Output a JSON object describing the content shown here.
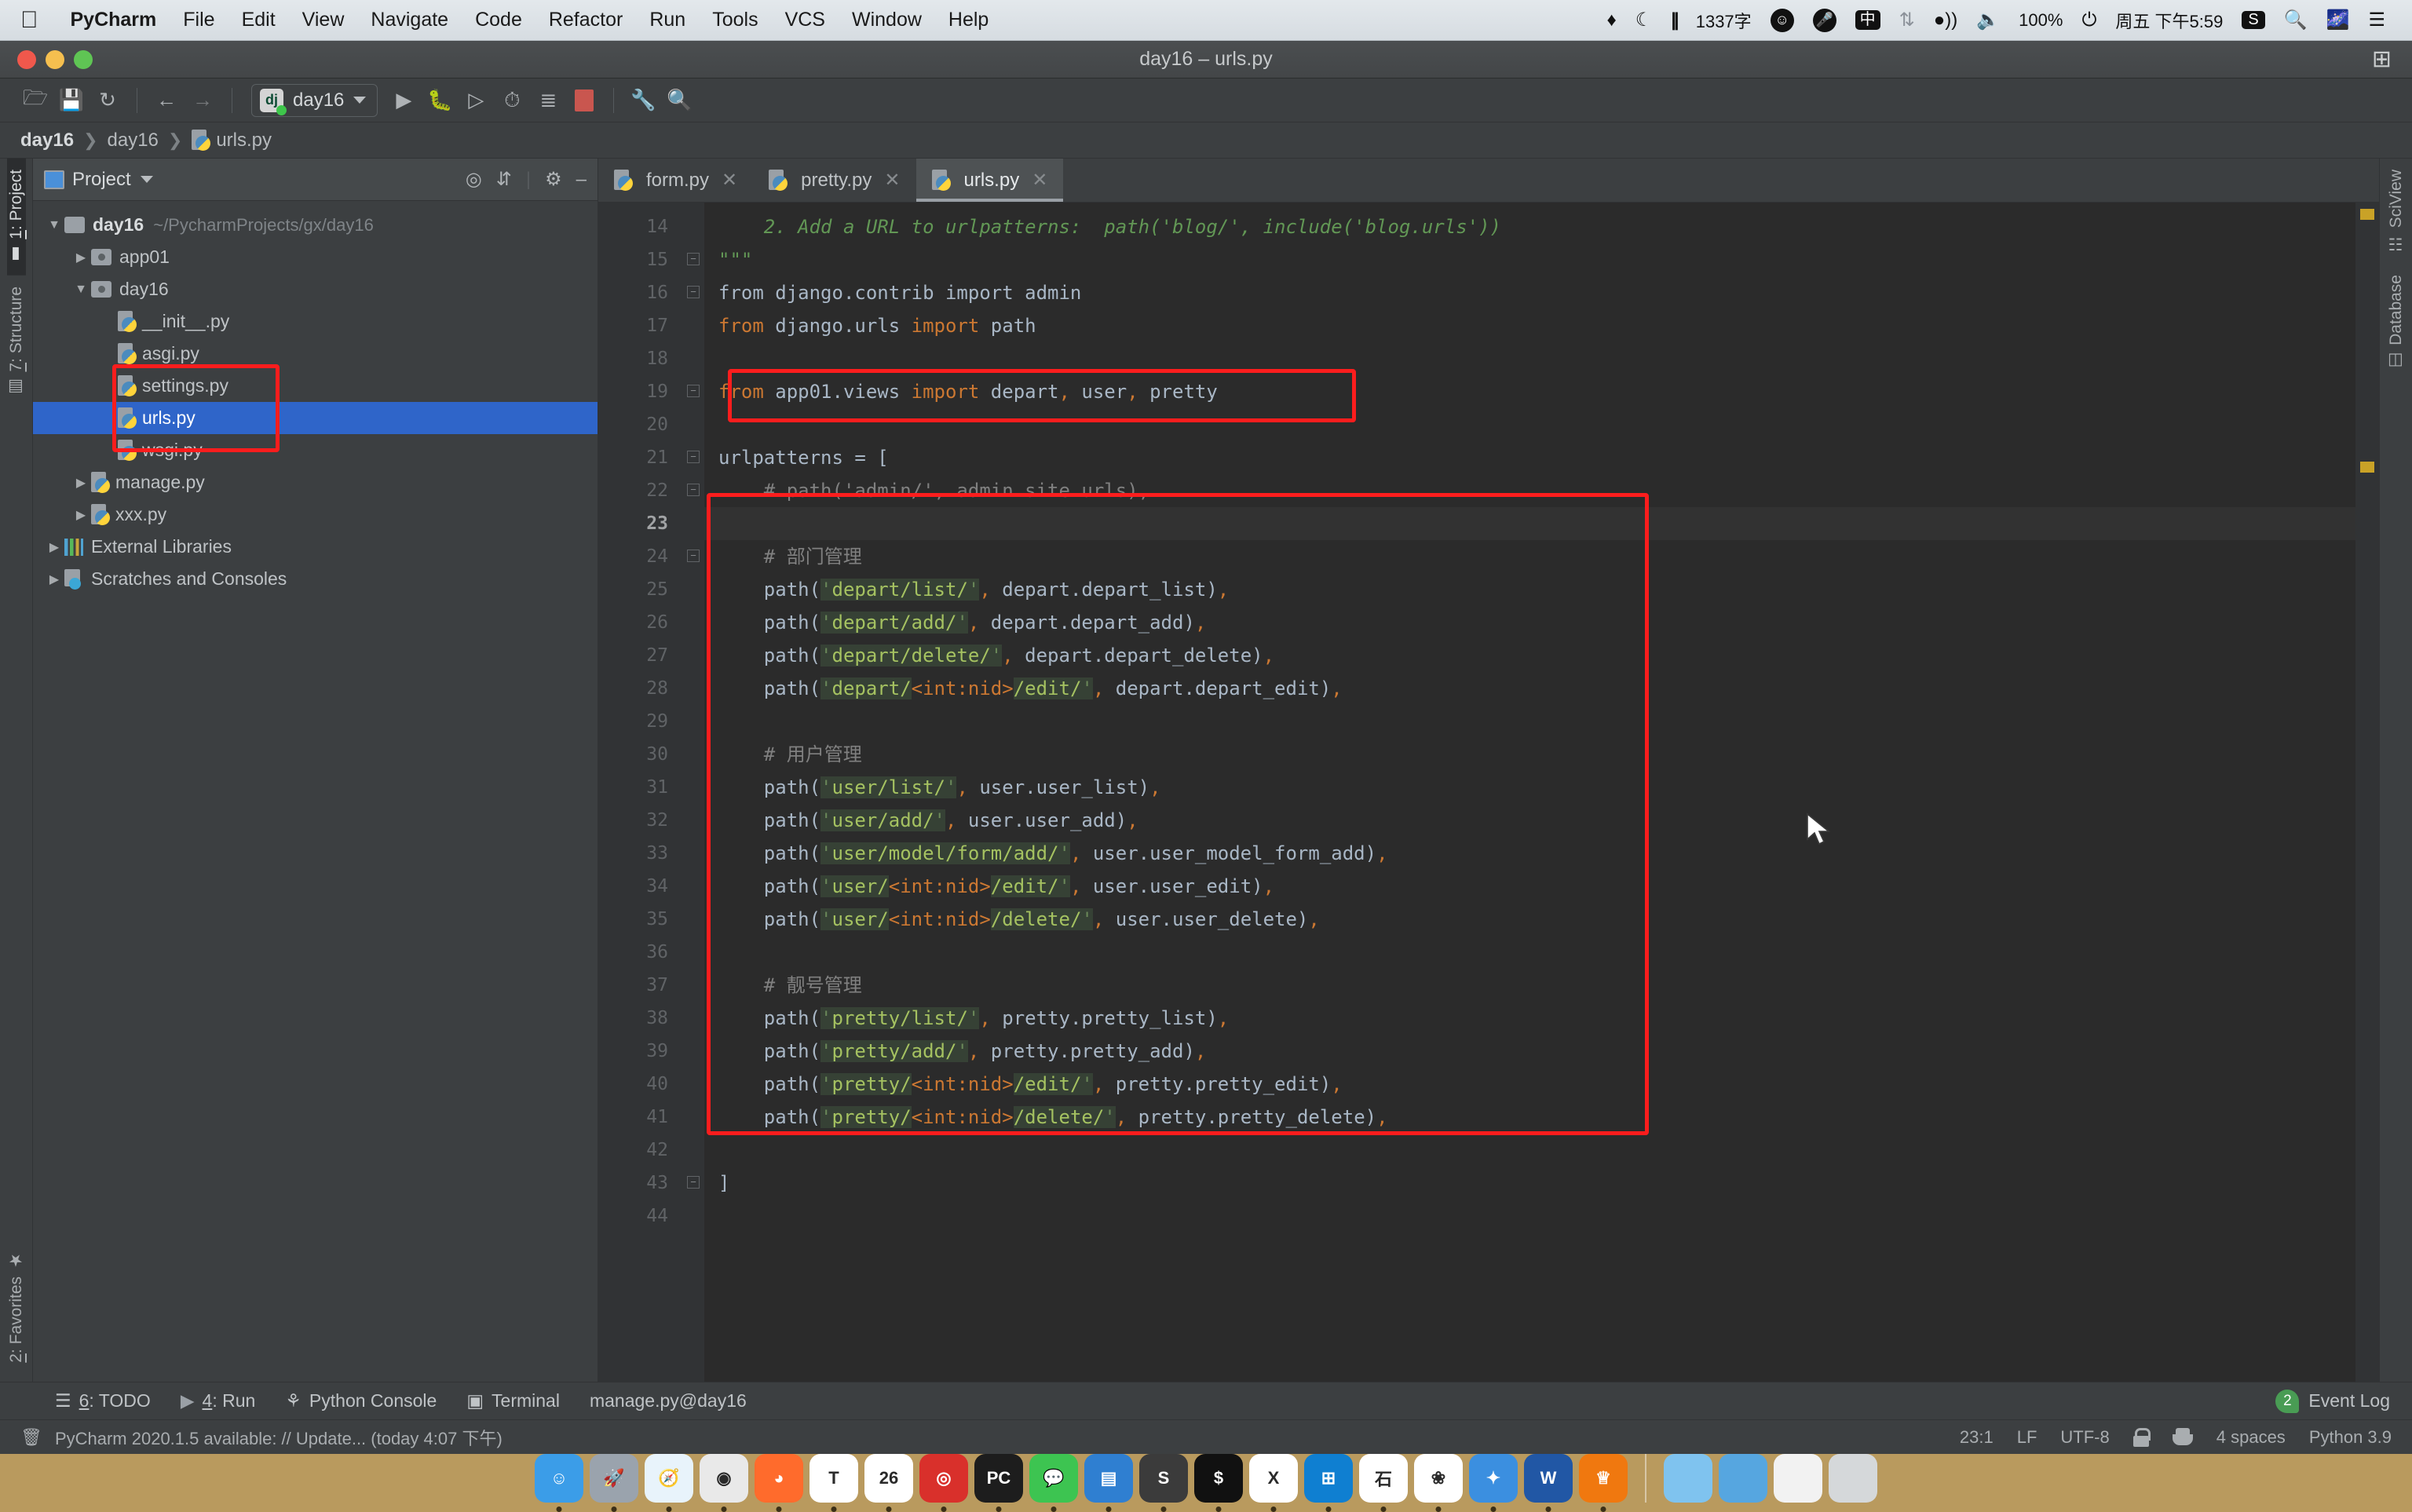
{
  "menubar": {
    "apple_icon": "apple-logo",
    "items": [
      {
        "label": "PyCharm",
        "bold": true
      },
      {
        "label": "File",
        "bold": false
      },
      {
        "label": "Edit",
        "bold": false
      },
      {
        "label": "View",
        "bold": false
      },
      {
        "label": "Navigate",
        "bold": false
      },
      {
        "label": "Code",
        "bold": false
      },
      {
        "label": "Refactor",
        "bold": false
      },
      {
        "label": "Run",
        "bold": false
      },
      {
        "label": "Tools",
        "bold": false
      },
      {
        "label": "VCS",
        "bold": false
      },
      {
        "label": "Window",
        "bold": false
      },
      {
        "label": "Help",
        "bold": false
      }
    ],
    "status_items": {
      "wordcount": "1337字",
      "input_method": "中",
      "battery_percent": "100%",
      "datetime": "周五 下午5:59"
    }
  },
  "window": {
    "title": "day16 – urls.py"
  },
  "toolbar": {
    "run_config": "day16",
    "run_config_badge": "dj"
  },
  "breadcrumbs": {
    "items": [
      "day16",
      "day16",
      "urls.py"
    ]
  },
  "left_strip": {
    "top": [
      {
        "num": "1",
        "label": ": Project",
        "active": true
      },
      {
        "num": "7",
        "label": ": Structure",
        "active": false
      }
    ],
    "bottom": [
      {
        "num": "2",
        "label": ": Favorites",
        "active": false
      }
    ]
  },
  "right_strip": {
    "items": [
      "SciView",
      "Database"
    ]
  },
  "project": {
    "header_title": "Project",
    "tree": [
      {
        "indent": 0,
        "arrow": "down",
        "icon": "folder",
        "label": "day16",
        "bold": true,
        "path": "~/PycharmProjects/gx/day16",
        "selected": false
      },
      {
        "indent": 1,
        "arrow": "right",
        "icon": "folder-src",
        "label": "app01",
        "bold": false,
        "path": "",
        "selected": false
      },
      {
        "indent": 1,
        "arrow": "down",
        "icon": "folder-src",
        "label": "day16",
        "bold": false,
        "path": "",
        "selected": false
      },
      {
        "indent": 2,
        "arrow": "none",
        "icon": "python-file",
        "label": "__init__.py",
        "bold": false,
        "path": "",
        "selected": false
      },
      {
        "indent": 2,
        "arrow": "none",
        "icon": "python-file",
        "label": "asgi.py",
        "bold": false,
        "path": "",
        "selected": false
      },
      {
        "indent": 2,
        "arrow": "none",
        "icon": "python-file",
        "label": "settings.py",
        "bold": false,
        "path": "",
        "selected": false
      },
      {
        "indent": 2,
        "arrow": "none",
        "icon": "python-file",
        "label": "urls.py",
        "bold": false,
        "path": "",
        "selected": true
      },
      {
        "indent": 2,
        "arrow": "none",
        "icon": "python-file",
        "label": "wsgi.py",
        "bold": false,
        "path": "",
        "selected": false
      },
      {
        "indent": 1,
        "arrow": "right",
        "icon": "python-file",
        "label": "manage.py",
        "bold": false,
        "path": "",
        "selected": false
      },
      {
        "indent": 1,
        "arrow": "right",
        "icon": "python-file",
        "label": "xxx.py",
        "bold": false,
        "path": "",
        "selected": false
      },
      {
        "indent": 0,
        "arrow": "right",
        "icon": "library",
        "label": "External Libraries",
        "bold": false,
        "path": "",
        "selected": false
      },
      {
        "indent": 0,
        "arrow": "right",
        "icon": "scratch",
        "label": "Scratches and Consoles",
        "bold": false,
        "path": "",
        "selected": false
      }
    ]
  },
  "tabs": [
    {
      "label": "form.py",
      "active": false
    },
    {
      "label": "pretty.py",
      "active": false
    },
    {
      "label": "urls.py",
      "active": true
    }
  ],
  "editor": {
    "first_line": 14,
    "lines": [
      {
        "n": 14,
        "tokens": [
          {
            "t": "    2. Add a URL to urlpatterns:  path('blog/', include('blog.urls'))",
            "c": "doc"
          }
        ]
      },
      {
        "n": 15,
        "tokens": [
          {
            "t": "\"\"\"",
            "c": "doc"
          }
        ]
      },
      {
        "n": 16,
        "tokens": [
          {
            "t": "from",
            "c": "plain"
          },
          {
            "t": " django.contrib ",
            "c": "plain"
          },
          {
            "t": "import",
            "c": "plain"
          },
          {
            "t": " admin",
            "c": "plain"
          }
        ]
      },
      {
        "n": 17,
        "tokens": [
          {
            "t": "from",
            "c": "kw"
          },
          {
            "t": " django.urls ",
            "c": "plain"
          },
          {
            "t": "import",
            "c": "kw"
          },
          {
            "t": " path",
            "c": "plain"
          }
        ]
      },
      {
        "n": 18,
        "tokens": []
      },
      {
        "n": 19,
        "tokens": [
          {
            "t": "from",
            "c": "kw"
          },
          {
            "t": " app01.views ",
            "c": "plain"
          },
          {
            "t": "import",
            "c": "kw"
          },
          {
            "t": " depart",
            "c": "plain"
          },
          {
            "t": ",",
            "c": "comma"
          },
          {
            "t": " user",
            "c": "plain"
          },
          {
            "t": ",",
            "c": "comma"
          },
          {
            "t": " pretty",
            "c": "plain"
          }
        ]
      },
      {
        "n": 20,
        "tokens": []
      },
      {
        "n": 21,
        "tokens": [
          {
            "t": "urlpatterns = [",
            "c": "plain"
          }
        ]
      },
      {
        "n": 22,
        "tokens": [
          {
            "t": "    # path('admin/', admin.site.urls),",
            "c": "cmt"
          }
        ]
      },
      {
        "n": 23,
        "tokens": [],
        "current": true
      },
      {
        "n": 24,
        "tokens": [
          {
            "t": "    # 部门管理",
            "c": "cmt"
          }
        ]
      },
      {
        "n": 25,
        "tokens": [
          {
            "t": "    path(",
            "c": "plain"
          },
          {
            "t": "'",
            "c": "strq"
          },
          {
            "t": "depart/list/",
            "c": "str"
          },
          {
            "t": "'",
            "c": "strq"
          },
          {
            "t": ",",
            "c": "comma"
          },
          {
            "t": " depart.depart_list)",
            "c": "plain"
          },
          {
            "t": ",",
            "c": "comma"
          }
        ]
      },
      {
        "n": 26,
        "tokens": [
          {
            "t": "    path(",
            "c": "plain"
          },
          {
            "t": "'",
            "c": "strq"
          },
          {
            "t": "depart/add/",
            "c": "str"
          },
          {
            "t": "'",
            "c": "strq"
          },
          {
            "t": ",",
            "c": "comma"
          },
          {
            "t": " depart.depart_add)",
            "c": "plain"
          },
          {
            "t": ",",
            "c": "comma"
          }
        ]
      },
      {
        "n": 27,
        "tokens": [
          {
            "t": "    path(",
            "c": "plain"
          },
          {
            "t": "'",
            "c": "strq"
          },
          {
            "t": "depart/delete/",
            "c": "str"
          },
          {
            "t": "'",
            "c": "strq"
          },
          {
            "t": ",",
            "c": "comma"
          },
          {
            "t": " depart.depart_delete)",
            "c": "plain"
          },
          {
            "t": ",",
            "c": "comma"
          }
        ]
      },
      {
        "n": 28,
        "tokens": [
          {
            "t": "    path(",
            "c": "plain"
          },
          {
            "t": "'",
            "c": "strq"
          },
          {
            "t": "depart/",
            "c": "str"
          },
          {
            "t": "<int:nid>",
            "c": "tmpl"
          },
          {
            "t": "/edit/",
            "c": "str"
          },
          {
            "t": "'",
            "c": "strq"
          },
          {
            "t": ",",
            "c": "comma"
          },
          {
            "t": " depart.depart_edit)",
            "c": "plain"
          },
          {
            "t": ",",
            "c": "comma"
          }
        ]
      },
      {
        "n": 29,
        "tokens": []
      },
      {
        "n": 30,
        "tokens": [
          {
            "t": "    # 用户管理",
            "c": "cmt"
          }
        ]
      },
      {
        "n": 31,
        "tokens": [
          {
            "t": "    path(",
            "c": "plain"
          },
          {
            "t": "'",
            "c": "strq"
          },
          {
            "t": "user/list/",
            "c": "str"
          },
          {
            "t": "'",
            "c": "strq"
          },
          {
            "t": ",",
            "c": "comma"
          },
          {
            "t": " user.user_list)",
            "c": "plain"
          },
          {
            "t": ",",
            "c": "comma"
          }
        ]
      },
      {
        "n": 32,
        "tokens": [
          {
            "t": "    path(",
            "c": "plain"
          },
          {
            "t": "'",
            "c": "strq"
          },
          {
            "t": "user/add/",
            "c": "str"
          },
          {
            "t": "'",
            "c": "strq"
          },
          {
            "t": ",",
            "c": "comma"
          },
          {
            "t": " user.user_add)",
            "c": "plain"
          },
          {
            "t": ",",
            "c": "comma"
          }
        ]
      },
      {
        "n": 33,
        "tokens": [
          {
            "t": "    path(",
            "c": "plain"
          },
          {
            "t": "'",
            "c": "strq"
          },
          {
            "t": "user/model/form/add/",
            "c": "str"
          },
          {
            "t": "'",
            "c": "strq"
          },
          {
            "t": ",",
            "c": "comma"
          },
          {
            "t": " user.user_model_form_add)",
            "c": "plain"
          },
          {
            "t": ",",
            "c": "comma"
          }
        ]
      },
      {
        "n": 34,
        "tokens": [
          {
            "t": "    path(",
            "c": "plain"
          },
          {
            "t": "'",
            "c": "strq"
          },
          {
            "t": "user/",
            "c": "str"
          },
          {
            "t": "<int:nid>",
            "c": "tmpl"
          },
          {
            "t": "/edit/",
            "c": "str"
          },
          {
            "t": "'",
            "c": "strq"
          },
          {
            "t": ",",
            "c": "comma"
          },
          {
            "t": " user.user_edit)",
            "c": "plain"
          },
          {
            "t": ",",
            "c": "comma"
          }
        ]
      },
      {
        "n": 35,
        "tokens": [
          {
            "t": "    path(",
            "c": "plain"
          },
          {
            "t": "'",
            "c": "strq"
          },
          {
            "t": "user/",
            "c": "str"
          },
          {
            "t": "<int:nid>",
            "c": "tmpl"
          },
          {
            "t": "/delete/",
            "c": "str"
          },
          {
            "t": "'",
            "c": "strq"
          },
          {
            "t": ",",
            "c": "comma"
          },
          {
            "t": " user.user_delete)",
            "c": "plain"
          },
          {
            "t": ",",
            "c": "comma"
          }
        ]
      },
      {
        "n": 36,
        "tokens": []
      },
      {
        "n": 37,
        "tokens": [
          {
            "t": "    # 靓号管理",
            "c": "cmt"
          }
        ]
      },
      {
        "n": 38,
        "tokens": [
          {
            "t": "    path(",
            "c": "plain"
          },
          {
            "t": "'",
            "c": "strq"
          },
          {
            "t": "pretty/list/",
            "c": "str"
          },
          {
            "t": "'",
            "c": "strq"
          },
          {
            "t": ",",
            "c": "comma"
          },
          {
            "t": " pretty.pretty_list)",
            "c": "plain"
          },
          {
            "t": ",",
            "c": "comma"
          }
        ]
      },
      {
        "n": 39,
        "tokens": [
          {
            "t": "    path(",
            "c": "plain"
          },
          {
            "t": "'",
            "c": "strq"
          },
          {
            "t": "pretty/add/",
            "c": "str"
          },
          {
            "t": "'",
            "c": "strq"
          },
          {
            "t": ",",
            "c": "comma"
          },
          {
            "t": " pretty.pretty_add)",
            "c": "plain"
          },
          {
            "t": ",",
            "c": "comma"
          }
        ]
      },
      {
        "n": 40,
        "tokens": [
          {
            "t": "    path(",
            "c": "plain"
          },
          {
            "t": "'",
            "c": "strq"
          },
          {
            "t": "pretty/",
            "c": "str"
          },
          {
            "t": "<int:nid>",
            "c": "tmpl"
          },
          {
            "t": "/edit/",
            "c": "str"
          },
          {
            "t": "'",
            "c": "strq"
          },
          {
            "t": ",",
            "c": "comma"
          },
          {
            "t": " pretty.pretty_edit)",
            "c": "plain"
          },
          {
            "t": ",",
            "c": "comma"
          }
        ]
      },
      {
        "n": 41,
        "tokens": [
          {
            "t": "    path(",
            "c": "plain"
          },
          {
            "t": "'",
            "c": "strq"
          },
          {
            "t": "pretty/",
            "c": "str"
          },
          {
            "t": "<int:nid>",
            "c": "tmpl"
          },
          {
            "t": "/delete/",
            "c": "str"
          },
          {
            "t": "'",
            "c": "strq"
          },
          {
            "t": ",",
            "c": "comma"
          },
          {
            "t": " pretty.pretty_delete)",
            "c": "plain"
          },
          {
            "t": ",",
            "c": "comma"
          }
        ]
      },
      {
        "n": 42,
        "tokens": []
      },
      {
        "n": 43,
        "tokens": [
          {
            "t": "]",
            "c": "plain"
          }
        ]
      },
      {
        "n": 44,
        "tokens": []
      }
    ]
  },
  "annotations": {
    "color": "#fc1d1d",
    "boxes": [
      {
        "name": "import-line-highlight"
      },
      {
        "name": "urlpatterns-block-highlight"
      },
      {
        "name": "urls-py-tree-highlight"
      }
    ]
  },
  "bottom_bar": {
    "items": [
      {
        "num": "6",
        "label": ": TODO",
        "icon": "list-icon"
      },
      {
        "num": "4",
        "label": ": Run",
        "icon": "play-icon"
      },
      {
        "num": "",
        "label": "Python Console",
        "icon": "python-icon"
      },
      {
        "num": "",
        "label": "Terminal",
        "icon": "terminal-icon"
      },
      {
        "num": "",
        "label": "manage.py@day16",
        "icon": ""
      }
    ],
    "event_log": {
      "label": "Event Log",
      "count": "2"
    }
  },
  "status_bar": {
    "message": "PyCharm 2020.1.5 available: // Update... (today 4:07 下午)",
    "caret": "23:1",
    "line_sep": "LF",
    "encoding": "UTF-8",
    "indent": "4 spaces",
    "interpreter": "Python 3.9"
  },
  "dock": {
    "apps": [
      {
        "name": "finder",
        "color": "#3b9de8",
        "glyph": "☺"
      },
      {
        "name": "launchpad",
        "color": "#9aa3ad",
        "glyph": "🚀"
      },
      {
        "name": "safari",
        "color": "#e8f3fb",
        "glyph": "🧭"
      },
      {
        "name": "chrome",
        "color": "#e9e9e9",
        "glyph": "◉"
      },
      {
        "name": "firefox",
        "color": "#ff6b2c",
        "glyph": "◕"
      },
      {
        "name": "typora",
        "color": "#ffffff",
        "glyph": "T"
      },
      {
        "name": "calendar",
        "color": "#ffffff",
        "glyph": "26"
      },
      {
        "name": "netease-music",
        "color": "#d9302b",
        "glyph": "◎"
      },
      {
        "name": "pycharm",
        "color": "#1d1d1d",
        "glyph": "PC"
      },
      {
        "name": "wechat",
        "color": "#3dc451",
        "glyph": "💬"
      },
      {
        "name": "keynote",
        "color": "#2f7fd1",
        "glyph": "▤"
      },
      {
        "name": "sublime",
        "color": "#3b3b3b",
        "glyph": "S"
      },
      {
        "name": "iterm",
        "color": "#111111",
        "glyph": "$"
      },
      {
        "name": "excel",
        "color": "#ffffff",
        "glyph": "X"
      },
      {
        "name": "parallels",
        "color": "#0f7fd1",
        "glyph": "⊞"
      },
      {
        "name": "shimo",
        "color": "#ffffff",
        "glyph": "石"
      },
      {
        "name": "photos",
        "color": "#ffffff",
        "glyph": "❀"
      },
      {
        "name": "evernote",
        "color": "#3b8fe0",
        "glyph": "✦"
      },
      {
        "name": "word",
        "color": "#2157a5",
        "glyph": "W"
      },
      {
        "name": "unknown-orange",
        "color": "#f0780f",
        "glyph": "♕"
      }
    ],
    "folders": [
      {
        "name": "downloads-folder",
        "color": "#7fc3ef"
      },
      {
        "name": "documents-folder",
        "color": "#56a6e0"
      },
      {
        "name": "document-preview",
        "color": "#f2f2f2"
      },
      {
        "name": "trash",
        "color": "#d5d8da"
      }
    ]
  }
}
